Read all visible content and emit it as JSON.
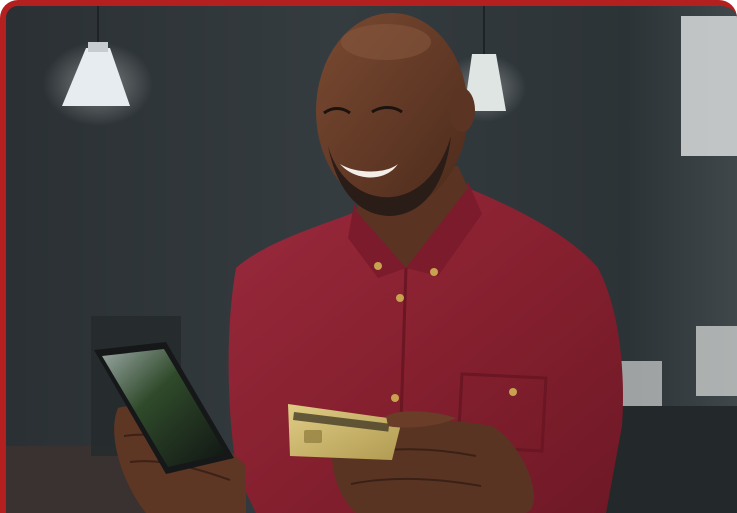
{
  "image": {
    "subject": "smiling-man-holding-phone-and-credit-card",
    "frame_color": "#b3201f",
    "palette": {
      "wall": "#30373b",
      "shirt": "#8b2034",
      "skin": "#5a3422",
      "card": "#c9b26a",
      "phone": "#1b1d1f",
      "lamp": "#e8edf0"
    }
  }
}
